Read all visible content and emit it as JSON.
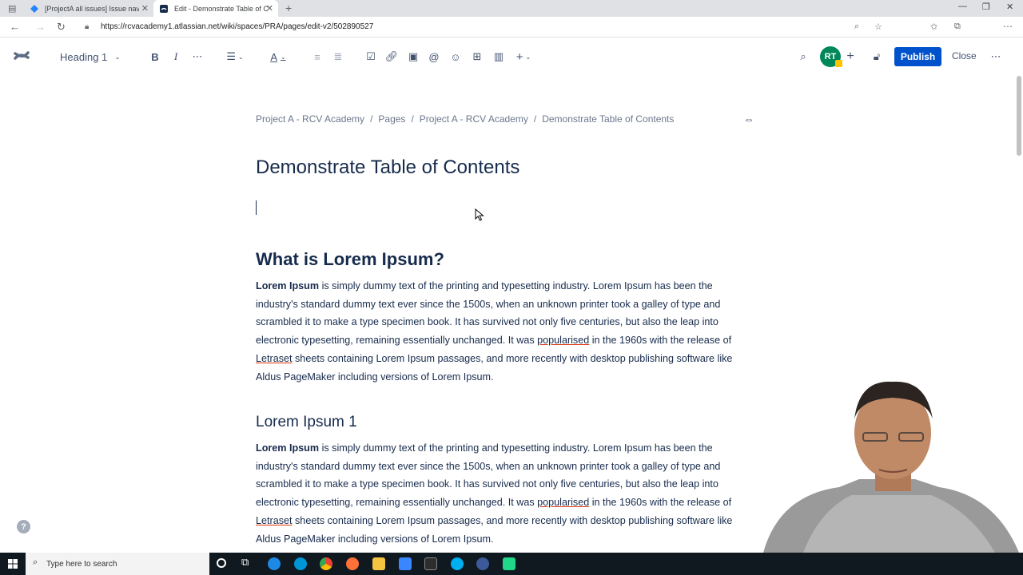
{
  "browser": {
    "tabs": [
      {
        "title": "[ProjectA all issues] Issue navigat"
      },
      {
        "title": "Edit - Demonstrate Table of Con"
      }
    ],
    "url": "https://rcvacademy1.atlassian.net/wiki/spaces/PRA/pages/edit-v2/502890527"
  },
  "toolbar": {
    "text_style": "Heading 1",
    "avatar_initials": "RT",
    "publish_label": "Publish",
    "close_label": "Close"
  },
  "breadcrumb": [
    "Project A - RCV Academy",
    "Pages",
    "Project A - RCV Academy",
    "Demonstrate Table of Contents"
  ],
  "page": {
    "title": "Demonstrate Table of Contents",
    "sections": [
      {
        "heading": "What is Lorem Ipsum?",
        "p_bold": "Lorem Ipsum",
        "p_1": " is simply dummy text of the printing and typesetting industry. Lorem Ipsum has been the industry's standard dummy text ever since the 1500s, when an unknown printer took a galley of type and scrambled it to make a type specimen book. It has survived not only five centuries, but also the leap into electronic typesetting, remaining essentially unchanged. It was ",
        "w_1": "popularised",
        "p_2": " in the 1960s with the release of ",
        "w_2": "Letraset",
        "p_3": " sheets containing Lorem Ipsum passages, and more recently with desktop publishing software like Aldus PageMaker including versions of Lorem Ipsum."
      },
      {
        "heading": "Lorem Ipsum 1",
        "p_bold": "Lorem Ipsum",
        "p_1": " is simply dummy text of the printing and typesetting industry. Lorem Ipsum has been the industry's standard dummy text ever since the 1500s, when an unknown printer took a galley of type and scrambled it to make a type specimen book. It has survived not only five centuries, but also the leap into electronic typesetting, remaining essentially unchanged. It was ",
        "w_1": "popularised",
        "p_2": " in the 1960s with the release of ",
        "w_2": "Letraset",
        "p_3": " sheets containing Lorem Ipsum passages, and more recently with desktop publishing software like Aldus PageMaker including versions of Lorem Ipsum."
      }
    ]
  },
  "taskbar": {
    "search_placeholder": "Type here to search"
  },
  "colors": {
    "primary": "#0052cc",
    "avatar": "#00875a",
    "text": "#172b4d",
    "muted": "#6b778c"
  }
}
